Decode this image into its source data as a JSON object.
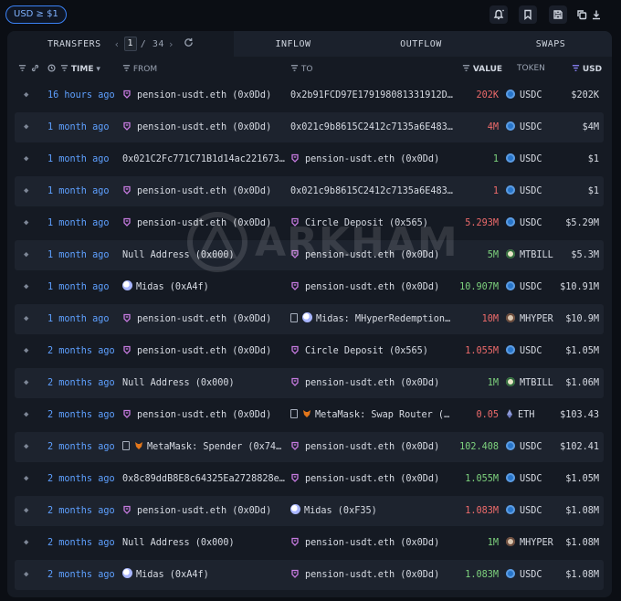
{
  "filter": {
    "label": "USD ≥ $1"
  },
  "toolbar": {
    "icons": [
      "alert-icon",
      "bookmark-icon",
      "save-icon",
      "copy-icon",
      "download-icon"
    ]
  },
  "tabs": {
    "transfers": "TRANSFERS",
    "inflow": "INFLOW",
    "outflow": "OUTFLOW",
    "swaps": "SWAPS"
  },
  "pager": {
    "current": "1",
    "total": "/ 34"
  },
  "columns": {
    "time": "TIME",
    "from": "FROM",
    "to": "TO",
    "value": "VALUE",
    "token": "TOKEN",
    "usd": "USD"
  },
  "watermark": "ARKHAM",
  "colors": {
    "accent": "#3b82f6",
    "time_link": "#5ea0ff",
    "outflow_value": "#ee6b6b",
    "inflow_value": "#7ed37e",
    "entity_icon": "#c77be0"
  },
  "rows": [
    {
      "time": "16 hours ago",
      "from": "pension-usdt.eth (0x0Dd)",
      "from_icon": "entity",
      "to": "0x2b91FCD97E179198081331912D…",
      "to_icon": "",
      "value": "202K",
      "flow": "out",
      "token": "USDC",
      "token_icon": "usdc",
      "usd": "$202K"
    },
    {
      "time": "1 month ago",
      "from": "pension-usdt.eth (0x0Dd)",
      "from_icon": "entity",
      "to": "0x021c9b8615C2412c7135a6E483…",
      "to_icon": "",
      "value": "4M",
      "flow": "out",
      "token": "USDC",
      "token_icon": "usdc",
      "usd": "$4M"
    },
    {
      "time": "1 month ago",
      "from": "0x021C2Fc771C71B1d14ac221673…",
      "from_icon": "",
      "to": "pension-usdt.eth (0x0Dd)",
      "to_icon": "entity",
      "value": "1",
      "flow": "in",
      "token": "USDC",
      "token_icon": "usdc",
      "usd": "$1"
    },
    {
      "time": "1 month ago",
      "from": "pension-usdt.eth (0x0Dd)",
      "from_icon": "entity",
      "to": "0x021c9b8615C2412c7135a6E483…",
      "to_icon": "",
      "value": "1",
      "flow": "out",
      "token": "USDC",
      "token_icon": "usdc",
      "usd": "$1"
    },
    {
      "time": "1 month ago",
      "from": "pension-usdt.eth (0x0Dd)",
      "from_icon": "entity",
      "to": "Circle Deposit (0x565)",
      "to_icon": "entity",
      "value": "5.293M",
      "flow": "out",
      "token": "USDC",
      "token_icon": "usdc",
      "usd": "$5.29M"
    },
    {
      "time": "1 month ago",
      "from": "Null Address (0x000)",
      "from_icon": "",
      "to": "pension-usdt.eth (0x0Dd)",
      "to_icon": "entity",
      "value": "5M",
      "flow": "in",
      "token": "MTBILL",
      "token_icon": "mtbill",
      "usd": "$5.3M"
    },
    {
      "time": "1 month ago",
      "from": "Midas (0xA4f)",
      "from_icon": "midas",
      "to": "pension-usdt.eth (0x0Dd)",
      "to_icon": "entity",
      "value": "10.907M",
      "flow": "in",
      "token": "USDC",
      "token_icon": "usdc",
      "usd": "$10.91M"
    },
    {
      "time": "1 month ago",
      "from": "pension-usdt.eth (0x0Dd)",
      "from_icon": "entity",
      "to": "Midas: MHyperRedemption…",
      "to_icon": "doc-midas",
      "value": "10M",
      "flow": "out",
      "token": "MHYPER",
      "token_icon": "mhyper",
      "usd": "$10.9M"
    },
    {
      "time": "2 months ago",
      "from": "pension-usdt.eth (0x0Dd)",
      "from_icon": "entity",
      "to": "Circle Deposit (0x565)",
      "to_icon": "entity",
      "value": "1.055M",
      "flow": "out",
      "token": "USDC",
      "token_icon": "usdc",
      "usd": "$1.05M"
    },
    {
      "time": "2 months ago",
      "from": "Null Address (0x000)",
      "from_icon": "",
      "to": "pension-usdt.eth (0x0Dd)",
      "to_icon": "entity",
      "value": "1M",
      "flow": "in",
      "token": "MTBILL",
      "token_icon": "mtbill",
      "usd": "$1.06M"
    },
    {
      "time": "2 months ago",
      "from": "pension-usdt.eth (0x0Dd)",
      "from_icon": "entity",
      "to": "MetaMask: Swap Router (…",
      "to_icon": "doc-fox",
      "value": "0.05",
      "flow": "out",
      "token": "ETH",
      "token_icon": "eth",
      "usd": "$103.43"
    },
    {
      "time": "2 months ago",
      "from": "MetaMask: Spender (0x74…",
      "from_icon": "doc-fox",
      "to": "pension-usdt.eth (0x0Dd)",
      "to_icon": "entity",
      "value": "102.408",
      "flow": "in",
      "token": "USDC",
      "token_icon": "usdc",
      "usd": "$102.41"
    },
    {
      "time": "2 months ago",
      "from": "0x8c89ddB8E8c64325Ea2728828e…",
      "from_icon": "",
      "to": "pension-usdt.eth (0x0Dd)",
      "to_icon": "entity",
      "value": "1.055M",
      "flow": "in",
      "token": "USDC",
      "token_icon": "usdc",
      "usd": "$1.05M"
    },
    {
      "time": "2 months ago",
      "from": "pension-usdt.eth (0x0Dd)",
      "from_icon": "entity",
      "to": "Midas (0xF35)",
      "to_icon": "midas",
      "value": "1.083M",
      "flow": "out",
      "token": "USDC",
      "token_icon": "usdc",
      "usd": "$1.08M"
    },
    {
      "time": "2 months ago",
      "from": "Null Address (0x000)",
      "from_icon": "",
      "to": "pension-usdt.eth (0x0Dd)",
      "to_icon": "entity",
      "value": "1M",
      "flow": "in",
      "token": "MHYPER",
      "token_icon": "mhyper",
      "usd": "$1.08M"
    },
    {
      "time": "2 months ago",
      "from": "Midas (0xA4f)",
      "from_icon": "midas",
      "to": "pension-usdt.eth (0x0Dd)",
      "to_icon": "entity",
      "value": "1.083M",
      "flow": "in",
      "token": "USDC",
      "token_icon": "usdc",
      "usd": "$1.08M"
    }
  ]
}
